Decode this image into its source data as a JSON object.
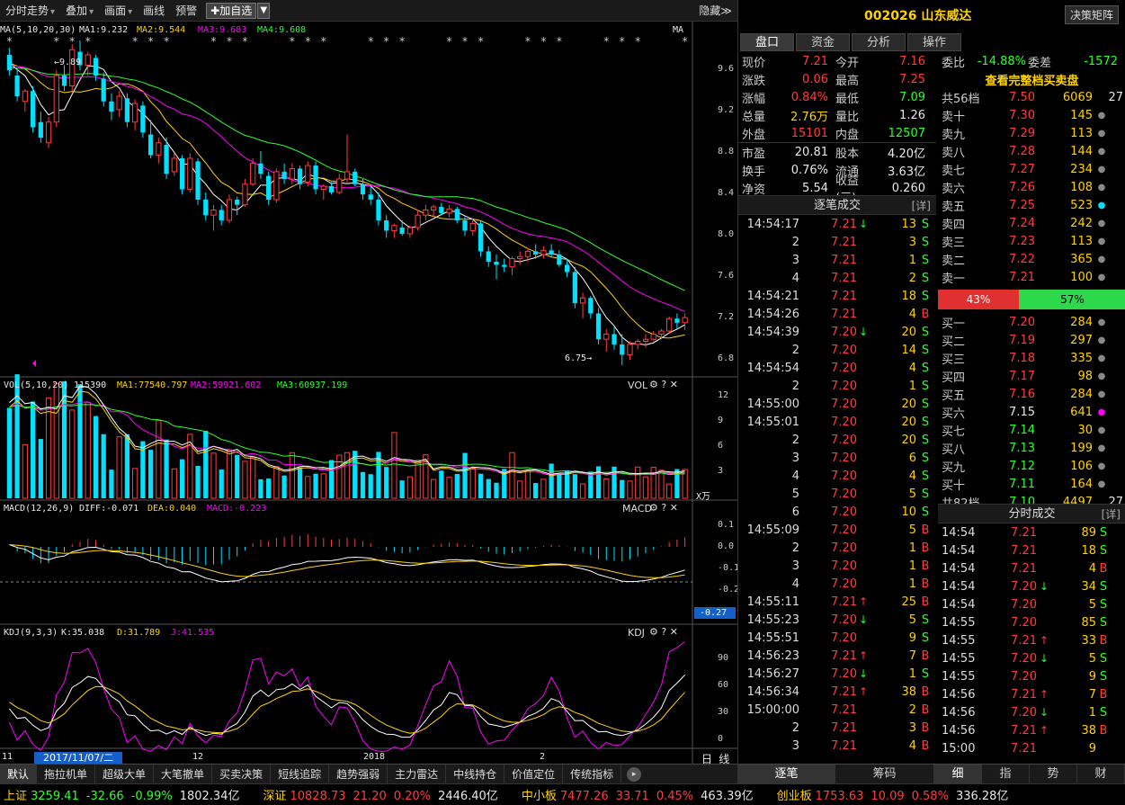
{
  "toolbar": {
    "items": [
      "分时走势",
      "叠加",
      "画面",
      "画线",
      "预警"
    ],
    "add_label": "✚加自选",
    "hide_label": "隐藏≫"
  },
  "stock": {
    "code_name": "002026 山东威达",
    "decision_btn": "决策矩阵"
  },
  "panel_tabs": [
    "盘口",
    "资金",
    "分析",
    "操作"
  ],
  "chart": {
    "ma_label": "MA(5,10,20,30)",
    "ma1": "MA1:9.232",
    "ma2": "MA2:9.544",
    "ma3": "MA3:9.683",
    "ma4": "MA4:9.608",
    "ma_tag": "MA",
    "high_mark": "←9.89",
    "low_mark": "6.75→",
    "price_axis": [
      "9.6",
      "9.2",
      "8.8",
      "8.4",
      "8.0",
      "7.6",
      "7.2",
      "6.8"
    ],
    "vol_label": "VOL(5,10,20)",
    "vol_value": "115390",
    "vol_ma1": "MA1:77540.797",
    "vol_ma2": "MA2:59921.602",
    "vol_ma3": "MA3:60937.199",
    "vol_tag": "VOL",
    "vol_axis": [
      "12",
      "9",
      "6",
      "3"
    ],
    "vol_unit": "X万",
    "macd_label": "MACD(12,26,9)",
    "diff": "DIFF:-0.071",
    "dea": "DEA:0.040",
    "macd": "MACD:-0.223",
    "macd_tag": "MACD",
    "macd_axis": [
      "0.1",
      "0.0",
      "-0.1",
      "-0.2"
    ],
    "macd_current": "-0.27",
    "kdj_label": "KDJ(9,3,3)",
    "k": "K:35.038",
    "d": "D:31.789",
    "j": "J:41.535",
    "kdj_tag": "KDJ",
    "kdj_axis": [
      "90",
      "60",
      "30",
      "0"
    ],
    "date_labels": [
      "11",
      "12",
      "2018",
      "2"
    ],
    "date_box": "2017/11/07/二",
    "period": "日 线"
  },
  "chart_data": {
    "type": "candlestick",
    "candles": [
      [
        9.75,
        9.82,
        9.55,
        9.6
      ],
      [
        9.55,
        9.62,
        9.3,
        9.35
      ],
      [
        9.3,
        9.42,
        9.2,
        9.4
      ],
      [
        9.4,
        9.45,
        9.0,
        9.05
      ],
      [
        9.1,
        9.2,
        8.9,
        8.95
      ],
      [
        8.9,
        9.15,
        8.85,
        9.1
      ],
      [
        9.1,
        9.6,
        9.05,
        9.55
      ],
      [
        9.55,
        9.65,
        9.4,
        9.45
      ],
      [
        9.45,
        9.85,
        9.4,
        9.8
      ],
      [
        9.78,
        9.89,
        9.6,
        9.65
      ],
      [
        9.65,
        9.78,
        9.55,
        9.75
      ],
      [
        9.72,
        9.75,
        9.5,
        9.55
      ],
      [
        9.52,
        9.58,
        9.25,
        9.3
      ],
      [
        9.3,
        9.38,
        9.12,
        9.2
      ],
      [
        9.22,
        9.4,
        9.15,
        9.35
      ],
      [
        9.33,
        9.38,
        9.05,
        9.1
      ],
      [
        9.1,
        9.32,
        9.02,
        9.28
      ],
      [
        9.26,
        9.3,
        8.95,
        9.0
      ],
      [
        8.98,
        9.12,
        8.75,
        8.78
      ],
      [
        8.78,
        8.95,
        8.7,
        8.9
      ],
      [
        8.88,
        8.95,
        8.55,
        8.6
      ],
      [
        8.62,
        8.8,
        8.58,
        8.75
      ],
      [
        8.75,
        8.78,
        8.4,
        8.45
      ],
      [
        8.45,
        8.8,
        8.42,
        8.75
      ],
      [
        8.72,
        8.75,
        8.3,
        8.35
      ],
      [
        8.35,
        8.42,
        8.15,
        8.2
      ],
      [
        8.2,
        8.3,
        8.05,
        8.25
      ],
      [
        8.25,
        8.3,
        8.1,
        8.15
      ],
      [
        8.15,
        8.4,
        8.12,
        8.35
      ],
      [
        8.35,
        8.38,
        8.2,
        8.3
      ],
      [
        8.3,
        8.55,
        8.28,
        8.5
      ],
      [
        8.5,
        8.75,
        8.48,
        8.7
      ],
      [
        8.7,
        8.82,
        8.55,
        8.6
      ],
      [
        8.58,
        8.62,
        8.3,
        8.35
      ],
      [
        8.35,
        8.65,
        8.32,
        8.62
      ],
      [
        8.62,
        8.7,
        8.5,
        8.55
      ],
      [
        8.55,
        8.7,
        8.5,
        8.65
      ],
      [
        8.65,
        8.68,
        8.45,
        8.5
      ],
      [
        8.52,
        8.72,
        8.48,
        8.68
      ],
      [
        8.68,
        8.72,
        8.4,
        8.45
      ],
      [
        8.45,
        8.5,
        8.35,
        8.48
      ],
      [
        8.48,
        8.52,
        8.4,
        8.42
      ],
      [
        8.42,
        8.6,
        8.4,
        8.55
      ],
      [
        8.55,
        8.98,
        8.5,
        8.62
      ],
      [
        8.62,
        8.65,
        8.48,
        8.5
      ],
      [
        8.5,
        8.55,
        8.35,
        8.4
      ],
      [
        8.4,
        8.48,
        8.3,
        8.35
      ],
      [
        8.35,
        8.42,
        8.1,
        8.15
      ],
      [
        8.15,
        8.2,
        7.98,
        8.05
      ],
      [
        8.05,
        8.12,
        7.98,
        8.1
      ],
      [
        8.08,
        8.15,
        8.0,
        8.02
      ],
      [
        8.02,
        8.1,
        7.98,
        8.08
      ],
      [
        8.08,
        8.25,
        8.05,
        8.2
      ],
      [
        8.2,
        8.3,
        8.15,
        8.25
      ],
      [
        8.25,
        8.3,
        8.18,
        8.28
      ],
      [
        8.28,
        8.32,
        8.2,
        8.22
      ],
      [
        8.22,
        8.3,
        8.18,
        8.26
      ],
      [
        8.26,
        8.28,
        8.12,
        8.15
      ],
      [
        8.15,
        8.2,
        8.0,
        8.05
      ],
      [
        8.05,
        8.15,
        8.0,
        8.12
      ],
      [
        8.12,
        8.14,
        7.8,
        7.85
      ],
      [
        7.85,
        7.9,
        7.7,
        7.75
      ],
      [
        7.75,
        7.82,
        7.58,
        7.72
      ],
      [
        7.72,
        7.78,
        7.65,
        7.7
      ],
      [
        7.7,
        7.8,
        7.62,
        7.78
      ],
      [
        7.78,
        7.85,
        7.72,
        7.8
      ],
      [
        7.8,
        7.88,
        7.75,
        7.85
      ],
      [
        7.85,
        7.92,
        7.78,
        7.82
      ],
      [
        7.82,
        7.9,
        7.78,
        7.86
      ],
      [
        7.86,
        7.92,
        7.8,
        7.82
      ],
      [
        7.82,
        7.86,
        7.7,
        7.72
      ],
      [
        7.72,
        7.78,
        7.6,
        7.65
      ],
      [
        7.65,
        7.7,
        7.3,
        7.35
      ],
      [
        7.35,
        7.45,
        7.2,
        7.4
      ],
      [
        7.4,
        7.42,
        7.2,
        7.25
      ],
      [
        7.25,
        7.3,
        6.95,
        7.0
      ],
      [
        7.0,
        7.1,
        6.88,
        7.05
      ],
      [
        7.05,
        7.12,
        6.9,
        6.95
      ],
      [
        6.95,
        7.05,
        6.75,
        6.85
      ],
      [
        6.85,
        6.98,
        6.8,
        6.95
      ],
      [
        6.95,
        7.0,
        6.9,
        6.98
      ],
      [
        6.98,
        7.05,
        6.92,
        7.0
      ],
      [
        7.0,
        7.08,
        6.98,
        7.05
      ],
      [
        7.05,
        7.1,
        7.0,
        7.08
      ],
      [
        7.08,
        7.22,
        7.05,
        7.2
      ],
      [
        7.2,
        7.25,
        7.1,
        7.16
      ],
      [
        7.16,
        7.25,
        7.09,
        7.21
      ]
    ],
    "ylim": [
      6.68,
      9.95
    ]
  },
  "quote": {
    "rows": [
      {
        "k": "现价",
        "v": "7.21",
        "vc": "red",
        "k2": "今开",
        "v2": "7.16",
        "v2c": "red"
      },
      {
        "k": "涨跌",
        "v": "0.06",
        "vc": "red",
        "k2": "最高",
        "v2": "7.25",
        "v2c": "red"
      },
      {
        "k": "涨幅",
        "v": "0.84%",
        "vc": "red",
        "k2": "最低",
        "v2": "7.09",
        "v2c": "green"
      },
      {
        "k": "总量",
        "v": "2.76万",
        "vc": "yellow",
        "k2": "量比",
        "v2": "1.26",
        "v2c": "white"
      },
      {
        "k": "外盘",
        "v": "15101",
        "vc": "red",
        "k2": "内盘",
        "v2": "12507",
        "v2c": "green"
      }
    ],
    "rows2": [
      {
        "k": "市盈",
        "v": "20.81",
        "vc": "white",
        "k2": "股本",
        "v2": "4.20亿",
        "v2c": "white"
      },
      {
        "k": "换手",
        "v": "0.76%",
        "vc": "white",
        "k2": "流通",
        "v2": "3.63亿",
        "v2c": "white"
      },
      {
        "k": "净资",
        "v": "5.54",
        "vc": "white",
        "k2": "收益(三)",
        "v2": "0.260",
        "v2c": "white"
      }
    ]
  },
  "ticks_section": {
    "title": "逐笔成交",
    "detail": "[详]"
  },
  "ticks": [
    {
      "t": "14:54:17",
      "p": "7.21",
      "pc": "red",
      "a": "↓",
      "ac": "green",
      "v": "13",
      "b": "S",
      "bc": "green"
    },
    {
      "t": "2",
      "p": "7.21",
      "pc": "red",
      "a": "",
      "ac": "",
      "v": "3",
      "b": "S",
      "bc": "green"
    },
    {
      "t": "3",
      "p": "7.21",
      "pc": "red",
      "a": "",
      "ac": "",
      "v": "1",
      "b": "S",
      "bc": "green"
    },
    {
      "t": "4",
      "p": "7.21",
      "pc": "red",
      "a": "",
      "ac": "",
      "v": "2",
      "b": "S",
      "bc": "green"
    },
    {
      "t": "14:54:21",
      "p": "7.21",
      "pc": "red",
      "a": "",
      "ac": "",
      "v": "18",
      "b": "S",
      "bc": "green"
    },
    {
      "t": "14:54:26",
      "p": "7.21",
      "pc": "red",
      "a": "",
      "ac": "",
      "v": "4",
      "b": "B",
      "bc": "red"
    },
    {
      "t": "14:54:39",
      "p": "7.20",
      "pc": "red",
      "a": "↓",
      "ac": "green",
      "v": "20",
      "b": "S",
      "bc": "green"
    },
    {
      "t": "2",
      "p": "7.20",
      "pc": "red",
      "a": "",
      "ac": "",
      "v": "14",
      "b": "S",
      "bc": "green"
    },
    {
      "t": "14:54:54",
      "p": "7.20",
      "pc": "red",
      "a": "",
      "ac": "",
      "v": "4",
      "b": "S",
      "bc": "green"
    },
    {
      "t": "2",
      "p": "7.20",
      "pc": "red",
      "a": "",
      "ac": "",
      "v": "1",
      "b": "S",
      "bc": "green"
    },
    {
      "t": "14:55:00",
      "p": "7.20",
      "pc": "red",
      "a": "",
      "ac": "",
      "v": "20",
      "b": "S",
      "bc": "green"
    },
    {
      "t": "14:55:01",
      "p": "7.20",
      "pc": "red",
      "a": "",
      "ac": "",
      "v": "20",
      "b": "S",
      "bc": "green"
    },
    {
      "t": "2",
      "p": "7.20",
      "pc": "red",
      "a": "",
      "ac": "",
      "v": "20",
      "b": "S",
      "bc": "green"
    },
    {
      "t": "3",
      "p": "7.20",
      "pc": "red",
      "a": "",
      "ac": "",
      "v": "6",
      "b": "S",
      "bc": "green"
    },
    {
      "t": "4",
      "p": "7.20",
      "pc": "red",
      "a": "",
      "ac": "",
      "v": "4",
      "b": "S",
      "bc": "green"
    },
    {
      "t": "5",
      "p": "7.20",
      "pc": "red",
      "a": "",
      "ac": "",
      "v": "5",
      "b": "S",
      "bc": "green"
    },
    {
      "t": "6",
      "p": "7.20",
      "pc": "red",
      "a": "",
      "ac": "",
      "v": "10",
      "b": "S",
      "bc": "green"
    },
    {
      "t": "14:55:09",
      "p": "7.20",
      "pc": "red",
      "a": "",
      "ac": "",
      "v": "5",
      "b": "B",
      "bc": "red"
    },
    {
      "t": "2",
      "p": "7.20",
      "pc": "red",
      "a": "",
      "ac": "",
      "v": "1",
      "b": "B",
      "bc": "red"
    },
    {
      "t": "3",
      "p": "7.20",
      "pc": "red",
      "a": "",
      "ac": "",
      "v": "1",
      "b": "B",
      "bc": "red"
    },
    {
      "t": "4",
      "p": "7.20",
      "pc": "red",
      "a": "",
      "ac": "",
      "v": "1",
      "b": "B",
      "bc": "red"
    },
    {
      "t": "14:55:11",
      "p": "7.21",
      "pc": "red",
      "a": "↑",
      "ac": "red",
      "v": "25",
      "b": "B",
      "bc": "red"
    },
    {
      "t": "14:55:23",
      "p": "7.20",
      "pc": "red",
      "a": "↓",
      "ac": "green",
      "v": "5",
      "b": "S",
      "bc": "green"
    },
    {
      "t": "14:55:51",
      "p": "7.20",
      "pc": "red",
      "a": "",
      "ac": "",
      "v": "9",
      "b": "S",
      "bc": "green"
    },
    {
      "t": "14:56:23",
      "p": "7.21",
      "pc": "red",
      "a": "↑",
      "ac": "red",
      "v": "7",
      "b": "B",
      "bc": "red"
    },
    {
      "t": "14:56:27",
      "p": "7.20",
      "pc": "red",
      "a": "↓",
      "ac": "green",
      "v": "1",
      "b": "S",
      "bc": "green"
    },
    {
      "t": "14:56:34",
      "p": "7.21",
      "pc": "red",
      "a": "↑",
      "ac": "red",
      "v": "38",
      "b": "B",
      "bc": "red"
    },
    {
      "t": "15:00:00",
      "p": "7.21",
      "pc": "red",
      "a": "",
      "ac": "",
      "v": "2",
      "b": "B",
      "bc": "red"
    },
    {
      "t": "2",
      "p": "7.21",
      "pc": "red",
      "a": "",
      "ac": "",
      "v": "3",
      "b": "B",
      "bc": "red"
    },
    {
      "t": "3",
      "p": "7.21",
      "pc": "red",
      "a": "",
      "ac": "",
      "v": "4",
      "b": "B",
      "bc": "red"
    }
  ],
  "book": {
    "weibi_label": "委比",
    "weibi": "-14.88%",
    "weicha_label": "委差",
    "weicha": "-1572",
    "full_label": "查看完整档买卖盘",
    "sell_total": {
      "l": "共56档",
      "p": "7.50",
      "v": "6069",
      "n": "27"
    },
    "sells": [
      {
        "l": "卖十",
        "p": "7.30",
        "v": "145",
        "d": "●",
        "dc": "#888"
      },
      {
        "l": "卖九",
        "p": "7.29",
        "v": "113",
        "d": "●",
        "dc": "#888"
      },
      {
        "l": "卖八",
        "p": "7.28",
        "v": "144",
        "d": "●",
        "dc": "#888"
      },
      {
        "l": "卖七",
        "p": "7.27",
        "v": "234",
        "d": "●",
        "dc": "#888"
      },
      {
        "l": "卖六",
        "p": "7.26",
        "v": "108",
        "d": "●",
        "dc": "#888"
      },
      {
        "l": "卖五",
        "p": "7.25",
        "v": "523",
        "d": "●",
        "dc": "#00e0ff"
      },
      {
        "l": "卖四",
        "p": "7.24",
        "v": "242",
        "d": "●",
        "dc": "#888"
      },
      {
        "l": "卖三",
        "p": "7.23",
        "v": "113",
        "d": "●",
        "dc": "#888"
      },
      {
        "l": "卖二",
        "p": "7.22",
        "v": "365",
        "d": "●",
        "dc": "#888"
      },
      {
        "l": "卖一",
        "p": "7.21",
        "v": "100",
        "d": "●",
        "dc": "#888"
      }
    ],
    "ratio_sell": "43%",
    "ratio_buy": "57%",
    "ratio_sell_frac": 0.43,
    "buys": [
      {
        "l": "买一",
        "p": "7.20",
        "pc": "red",
        "v": "284",
        "d": "●",
        "dc": "#888"
      },
      {
        "l": "买二",
        "p": "7.19",
        "pc": "red",
        "v": "297",
        "d": "●",
        "dc": "#888"
      },
      {
        "l": "买三",
        "p": "7.18",
        "pc": "red",
        "v": "335",
        "d": "●",
        "dc": "#888"
      },
      {
        "l": "买四",
        "p": "7.17",
        "pc": "red",
        "v": "98",
        "d": "●",
        "dc": "#888"
      },
      {
        "l": "买五",
        "p": "7.16",
        "pc": "red",
        "v": "284",
        "d": "●",
        "dc": "#888"
      },
      {
        "l": "买六",
        "p": "7.15",
        "pc": "white",
        "v": "641",
        "d": "●",
        "dc": "#ff00ff"
      },
      {
        "l": "买七",
        "p": "7.14",
        "pc": "green",
        "v": "30",
        "d": "●",
        "dc": "#888"
      },
      {
        "l": "买八",
        "p": "7.13",
        "pc": "green",
        "v": "199",
        "d": "●",
        "dc": "#888"
      },
      {
        "l": "买九",
        "p": "7.12",
        "pc": "green",
        "v": "106",
        "d": "●",
        "dc": "#888"
      },
      {
        "l": "买十",
        "p": "7.11",
        "pc": "green",
        "v": "164",
        "d": "●",
        "dc": "#888"
      }
    ],
    "buy_total": {
      "l": "共82档",
      "p": "7.10",
      "v": "4497",
      "n": "27"
    }
  },
  "fenshi_section": {
    "title": "分时成交",
    "detail": "[详]"
  },
  "fenshi": [
    {
      "t": "14:54",
      "p": "7.21",
      "pc": "red",
      "a": "",
      "ac": "",
      "v": "89",
      "b": "S",
      "bc": "green"
    },
    {
      "t": "14:54",
      "p": "7.21",
      "pc": "red",
      "a": "",
      "ac": "",
      "v": "18",
      "b": "S",
      "bc": "green"
    },
    {
      "t": "14:54",
      "p": "7.21",
      "pc": "red",
      "a": "",
      "ac": "",
      "v": "4",
      "b": "B",
      "bc": "red"
    },
    {
      "t": "14:54",
      "p": "7.20",
      "pc": "red",
      "a": "↓",
      "ac": "green",
      "v": "34",
      "b": "S",
      "bc": "green"
    },
    {
      "t": "14:54",
      "p": "7.20",
      "pc": "red",
      "a": "",
      "ac": "",
      "v": "5",
      "b": "S",
      "bc": "green"
    },
    {
      "t": "14:55",
      "p": "7.20",
      "pc": "red",
      "a": "",
      "ac": "",
      "v": "85",
      "b": "S",
      "bc": "green"
    },
    {
      "t": "14:55",
      "p": "7.21",
      "pc": "red",
      "a": "↑",
      "ac": "red",
      "v": "33",
      "b": "B",
      "bc": "red"
    },
    {
      "t": "14:55",
      "p": "7.20",
      "pc": "red",
      "a": "↓",
      "ac": "green",
      "v": "5",
      "b": "S",
      "bc": "green"
    },
    {
      "t": "14:55",
      "p": "7.20",
      "pc": "red",
      "a": "",
      "ac": "",
      "v": "9",
      "b": "S",
      "bc": "green"
    },
    {
      "t": "14:56",
      "p": "7.21",
      "pc": "red",
      "a": "↑",
      "ac": "red",
      "v": "7",
      "b": "B",
      "bc": "red"
    },
    {
      "t": "14:56",
      "p": "7.20",
      "pc": "red",
      "a": "↓",
      "ac": "green",
      "v": "1",
      "b": "S",
      "bc": "green"
    },
    {
      "t": "14:56",
      "p": "7.21",
      "pc": "red",
      "a": "↑",
      "ac": "red",
      "v": "38",
      "b": "B",
      "bc": "red"
    },
    {
      "t": "15:00",
      "p": "7.21",
      "pc": "red",
      "a": "",
      "ac": "",
      "v": "9",
      "b": "",
      "bc": ""
    }
  ],
  "bottom_tabs": [
    "默认",
    "拖拉机单",
    "超级大单",
    "大笔撤单",
    "买卖决策",
    "短线追踪",
    "趋势强弱",
    "主力雷达",
    "中线持仓",
    "价值定位",
    "传统指标"
  ],
  "right_bottom_tabs": [
    "逐笔",
    "筹码",
    "细",
    "指",
    "势",
    "财"
  ],
  "status": [
    {
      "name": "上证",
      "vals": [
        "3259.41",
        "-32.66",
        "-0.99%",
        "1802.34亿"
      ],
      "color": "green"
    },
    {
      "name": "深证",
      "vals": [
        "10828.73",
        "21.20",
        "0.20%",
        "2446.40亿"
      ],
      "color": "red"
    },
    {
      "name": "中小板",
      "vals": [
        "7477.26",
        "33.71",
        "0.45%",
        "463.39亿"
      ],
      "color": "red"
    },
    {
      "name": "创业板",
      "vals": [
        "1753.63",
        "10.09",
        "0.58%",
        "336.28亿"
      ],
      "color": "red"
    }
  ]
}
